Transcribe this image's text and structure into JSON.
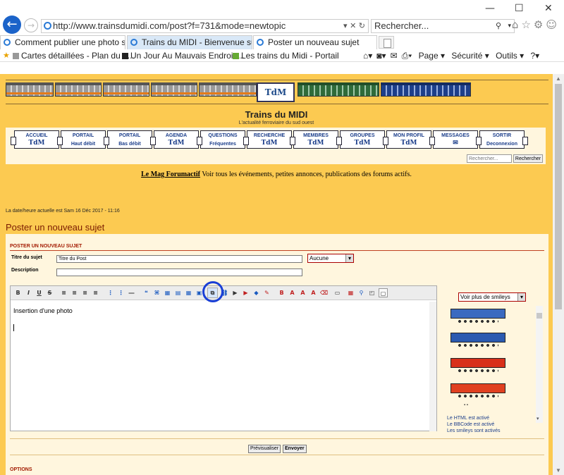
{
  "browser": {
    "url": "http://www.trainsdumidi.com/post?f=731&mode=newtopic",
    "search_placeholder": "Rechercher...",
    "window_controls": [
      "—",
      "☐",
      "✕"
    ],
    "tabs": [
      {
        "label": "Comment publier une photo sur..."
      },
      {
        "label": "Trains du MIDI - Bienvenue sur v..."
      },
      {
        "label": "Poster un nouveau sujet"
      }
    ],
    "favorites": [
      {
        "label": "Cartes détaillées - Plan du tr..."
      },
      {
        "label": "Un Jour Au Mauvais Endroit ..."
      },
      {
        "label": "Les trains du Midi - Portail"
      }
    ],
    "ie_tools": [
      "Page ▾",
      "Sécurité ▾",
      "Outils ▾"
    ]
  },
  "site": {
    "logo_sign": "TdM",
    "title": "Trains du MIDI",
    "subtitle": "L'actualité ferroviaire du sud ouest",
    "nav": [
      {
        "top": "ACCUEIL",
        "bottom": "TdM"
      },
      {
        "top": "PORTAIL",
        "bottom": "Haut débit"
      },
      {
        "top": "PORTAIL",
        "bottom": "Bas débit"
      },
      {
        "top": "AGENDA",
        "bottom": "TdM"
      },
      {
        "top": "QUESTIONS",
        "bottom": "Fréquentes"
      },
      {
        "top": "RECHERCHE",
        "bottom": "TdM"
      },
      {
        "top": "MEMBRES",
        "bottom": "TdM"
      },
      {
        "top": "GROUPES",
        "bottom": "TdM"
      },
      {
        "top": "MON PROFIL",
        "bottom": "TdM"
      },
      {
        "top": "MESSAGES",
        "bottom": "✉"
      },
      {
        "top": "SORTIR",
        "bottom": "Deconnexion"
      }
    ],
    "search_placeholder": "Rechercher...",
    "search_button": "Rechercher",
    "forumactif_link": "Le Mag Forumactif",
    "forumactif_text": " Voir tous les événements, petites annonces, publications des forums actifs.",
    "date_line": "La date/heure actuelle est Sam 16 Déc 2017 - 11:16",
    "page_title": "Poster un nouveau sujet"
  },
  "form": {
    "header": "POSTER UN NOUVEAU SUJET",
    "subject_label": "Titre du sujet",
    "subject_value": "Titre du Post",
    "select_value": "Aucune",
    "description_label": "Description",
    "description_value": "",
    "editor_text": "Insertion d'une photo",
    "smileys_select": "Voir plus de smileys",
    "html_status": "Le HTML est activé",
    "bbcode_status": "Le BBCode est activé",
    "smileys_status": "Les smileys sont activés",
    "preview_button": "Prévisualiser",
    "send_button": "Envoyer",
    "options_header": "OPTIONS",
    "highlight_color": "#1a3fd6"
  },
  "toolbar_icons": [
    {
      "name": "bold-icon",
      "glyph": "B"
    },
    {
      "name": "italic-icon",
      "glyph": "I"
    },
    {
      "name": "underline-icon",
      "glyph": "U"
    },
    {
      "name": "strike-icon",
      "glyph": "S"
    },
    {
      "name": "align-left-icon",
      "glyph": "≡"
    },
    {
      "name": "align-center-icon",
      "glyph": "≡"
    },
    {
      "name": "align-right-icon",
      "glyph": "≡"
    },
    {
      "name": "justify-icon",
      "glyph": "≡"
    },
    {
      "name": "bullet-list-icon",
      "glyph": "⋮"
    },
    {
      "name": "numbered-list-icon",
      "glyph": "⋮"
    },
    {
      "name": "hr-icon",
      "glyph": "―"
    },
    {
      "name": "quote-icon",
      "glyph": "❝"
    },
    {
      "name": "code-icon",
      "glyph": "⌘"
    },
    {
      "name": "spoiler-icon",
      "glyph": "▦"
    },
    {
      "name": "hide-icon",
      "glyph": "▤"
    },
    {
      "name": "table-icon",
      "glyph": "▦"
    },
    {
      "name": "image-icon",
      "glyph": "▣"
    },
    {
      "name": "host-image-icon",
      "glyph": "⧉"
    },
    {
      "name": "link-icon",
      "glyph": "⛓"
    },
    {
      "name": "video-icon",
      "glyph": "▶"
    },
    {
      "name": "youtube-icon",
      "glyph": "▶"
    },
    {
      "name": "flash-icon",
      "glyph": "◆"
    },
    {
      "name": "pen-icon",
      "glyph": "✎"
    },
    {
      "name": "bold-text-icon",
      "glyph": "B"
    },
    {
      "name": "color-icon",
      "glyph": "A"
    },
    {
      "name": "size-icon",
      "glyph": "A"
    },
    {
      "name": "font-icon",
      "glyph": "A"
    },
    {
      "name": "eraser-icon",
      "glyph": "⌫"
    },
    {
      "name": "horizontal-rule-icon",
      "glyph": "▭"
    },
    {
      "name": "date-icon",
      "glyph": "▦"
    },
    {
      "name": "search-icon",
      "glyph": "⚲"
    },
    {
      "name": "source-icon",
      "glyph": "◰"
    },
    {
      "name": "toggle-mode-icon",
      "glyph": "▢"
    }
  ]
}
